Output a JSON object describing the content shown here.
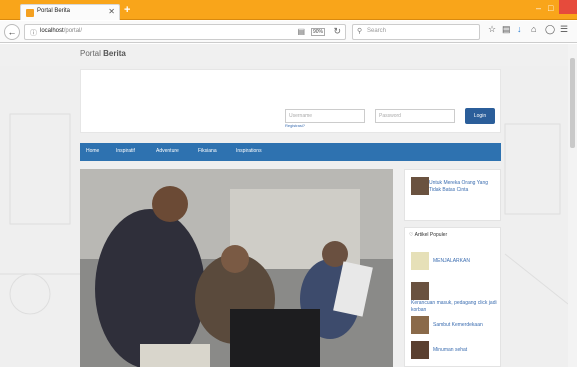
{
  "browser": {
    "tab_title": "Portal Berita",
    "tab_close": "✕",
    "new_tab": "+",
    "url_host": "localhost",
    "url_path": "/portal/",
    "zoom": "90%",
    "search_placeholder": "Search"
  },
  "site": {
    "brand_prefix": "Portal",
    "brand_bold": "Berita",
    "login": {
      "username_placeholder": "Username",
      "password_placeholder": "Password",
      "register": "Registrasi?",
      "login_button": "Login"
    },
    "nav": [
      {
        "label": "Home"
      },
      {
        "label": "Inspiratif"
      },
      {
        "label": "Adventure"
      },
      {
        "label": "Fiksiana"
      },
      {
        "label": "Inspirations"
      }
    ],
    "featured": {
      "title": "Untuk Mereka Orang Yang Tidak Batas Cinta"
    },
    "popular": {
      "heading": "Artikel Populer",
      "items": [
        {
          "title": "MENJALARKAN"
        },
        {
          "title": "Kerancuan masuk, pedagang click jadi korban"
        },
        {
          "title": "Sambut Kemerdekaan"
        },
        {
          "title": "Minuman sehat"
        }
      ]
    }
  },
  "colors": {
    "browser_chrome": "#f9a51a",
    "navbar": "#2e72b0",
    "login_button": "#2b5e9a",
    "link": "#3b6db0"
  }
}
